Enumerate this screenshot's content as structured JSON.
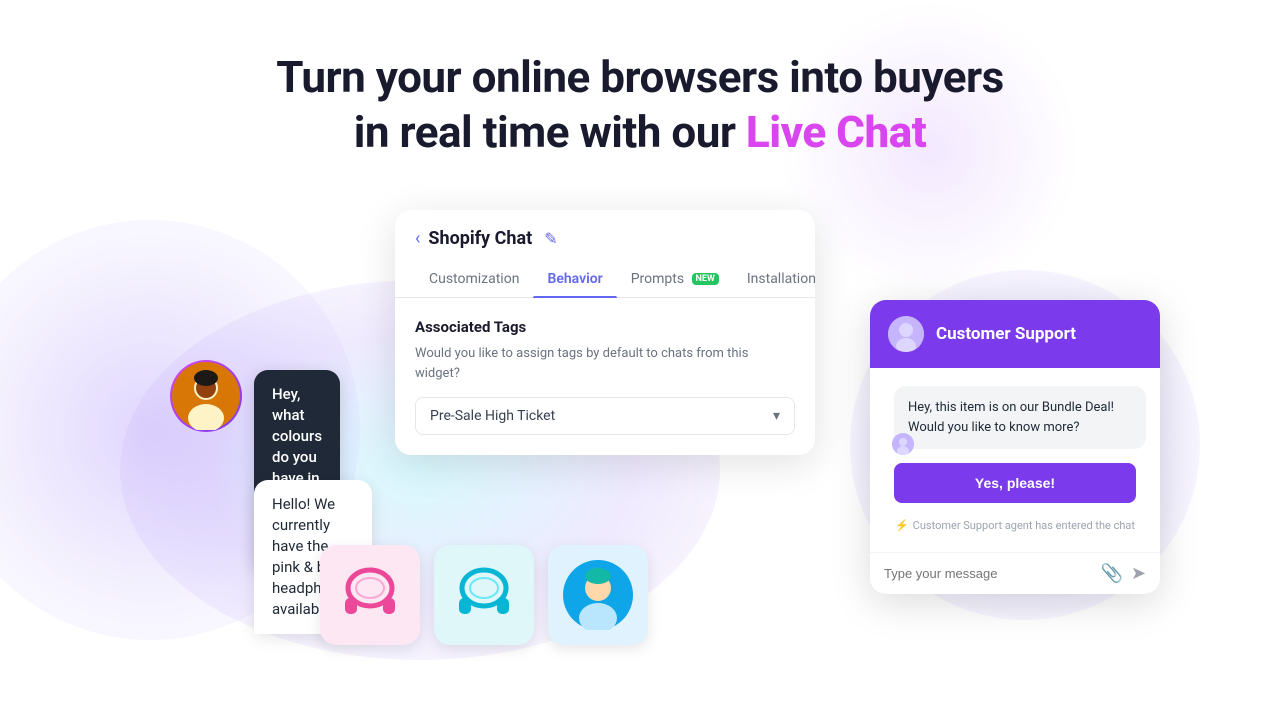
{
  "hero": {
    "line1": "Turn your online browsers into buyers",
    "line2_prefix": "in real time with our ",
    "line2_highlight": "Live Chat"
  },
  "shopify_panel": {
    "back_label": "‹",
    "title": "Shopify Chat",
    "edit_icon": "✎",
    "tabs": [
      {
        "label": "Customization",
        "active": false
      },
      {
        "label": "Behavior",
        "active": true
      },
      {
        "label": "Prompts",
        "active": false,
        "badge": "NEW"
      },
      {
        "label": "Installation",
        "active": false
      }
    ],
    "section_title": "Associated Tags",
    "section_desc": "Would you like to assign tags by default to chats from this widget?",
    "dropdown_value": "Pre-Sale High Ticket",
    "dropdown_chevron": "▾"
  },
  "user_chat": {
    "bubble1": "Hey, what colours do you have in stock right now?",
    "bubble2": "Hello! We currently have the pink & blue headphones available."
  },
  "products": [
    {
      "type": "pink_headphones",
      "bg": "pink"
    },
    {
      "type": "teal_headphones",
      "bg": "teal"
    },
    {
      "type": "person",
      "bg": "person"
    }
  ],
  "cs_panel": {
    "title": "Customer Support",
    "message_line1": "Hey, this item is on our Bundle Deal!",
    "message_line2": "Would you like to know more?",
    "yes_button": "Yes, please!",
    "status_text": "Customer Support agent has entered the chat",
    "input_placeholder": "Type your message"
  }
}
